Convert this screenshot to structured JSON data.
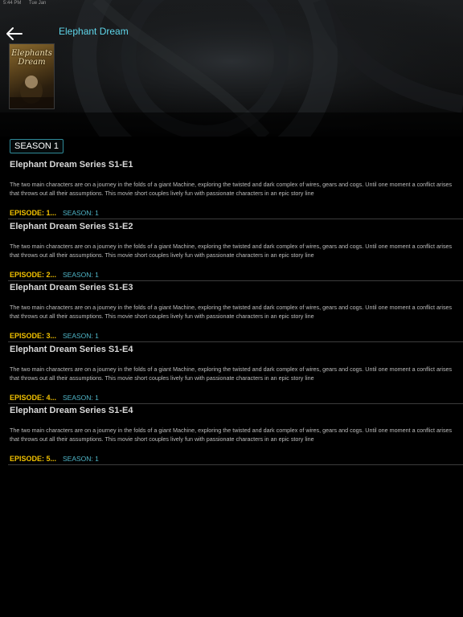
{
  "status_bar": {
    "time": "5:44 PM",
    "date": "Tue Jan"
  },
  "header": {
    "title": "Elephant Dream"
  },
  "poster": {
    "title_line1": "Elephants",
    "title_line2": "Dream"
  },
  "seasons": [
    {
      "label": "SEASON 1",
      "selected": true
    }
  ],
  "episodes": [
    {
      "title": "Elephant Dream Series S1-E1",
      "description": "The two main characters are on a journey in the folds of a giant Machine, exploring the twisted and dark complex of wires, gears and cogs. Until one moment a conflict arises that throws out all their assumptions. This movie short couples lively fun with passionate characters in an epic story line",
      "episode_label": "EPISODE: 1...",
      "season_label": "SEASON: 1"
    },
    {
      "title": "Elephant Dream Series S1-E2",
      "description": "The two main characters are on a journey in the folds of a giant Machine, exploring the twisted and dark complex of wires, gears and cogs. Until one moment a conflict arises that throws out all their assumptions. This movie short couples lively fun with passionate characters in an epic story line",
      "episode_label": "EPISODE: 2...",
      "season_label": "SEASON: 1"
    },
    {
      "title": "Elephant Dream Series S1-E3",
      "description": "The two main characters are on a journey in the folds of a giant Machine, exploring the twisted and dark complex of wires, gears and cogs. Until one moment a conflict arises that throws out all their assumptions. This movie short couples lively fun with passionate characters in an epic story line",
      "episode_label": "EPISODE: 3...",
      "season_label": "SEASON: 1"
    },
    {
      "title": "Elephant Dream Series S1-E4",
      "description": "The two main characters are on a journey in the folds of a giant Machine, exploring the twisted and dark complex of wires, gears and cogs. Until one moment a conflict arises that throws out all their assumptions. This movie short couples lively fun with passionate characters in an epic story line",
      "episode_label": "EPISODE: 4...",
      "season_label": "SEASON: 1"
    },
    {
      "title": "Elephant Dream Series S1-E4",
      "description": "The two main characters are on a journey in the folds of a giant Machine, exploring the twisted and dark complex of wires, gears and cogs. Until one moment a conflict arises that throws out all their assumptions. This movie short couples lively fun with passionate characters in an epic story line",
      "episode_label": "EPISODE: 5...",
      "season_label": "SEASON: 1"
    }
  ],
  "colors": {
    "background": "#000000",
    "title_accent": "#5fd6ea",
    "episode_label": "#f2c200",
    "season_label": "#4fb6c8",
    "divider": "#3c3c3c"
  }
}
